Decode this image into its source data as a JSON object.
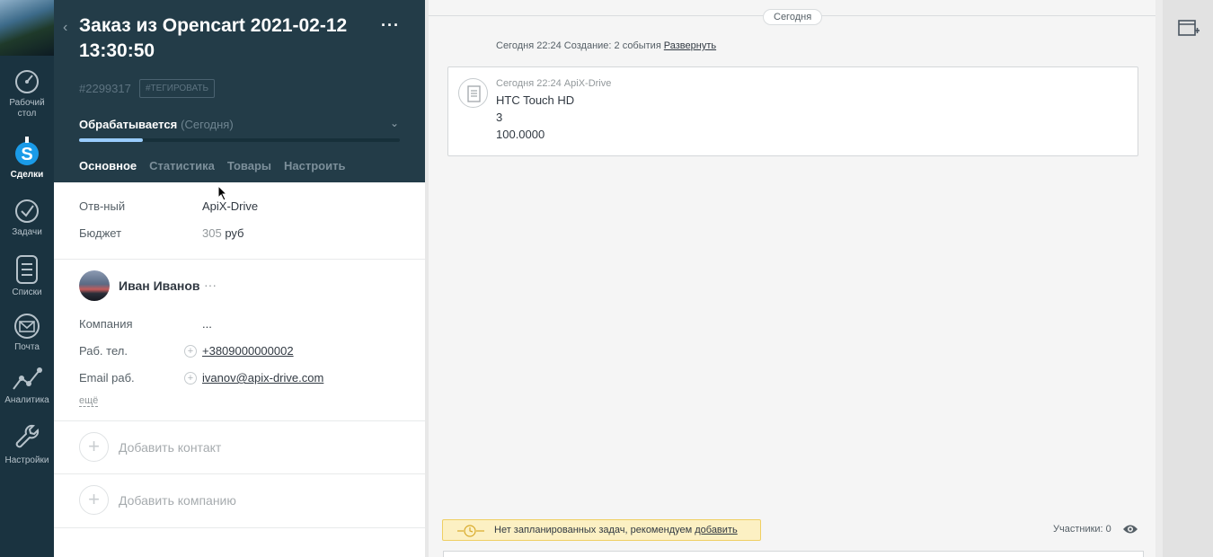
{
  "nav": {
    "items": [
      {
        "label": "Рабочий стол",
        "icon": "dashboard-icon"
      },
      {
        "label": "Сделки",
        "icon": "deals-icon"
      },
      {
        "label": "Задачи",
        "icon": "tasks-icon"
      },
      {
        "label": "Списки",
        "icon": "lists-icon"
      },
      {
        "label": "Почта",
        "icon": "mail-icon"
      },
      {
        "label": "Аналитика",
        "icon": "analytics-icon"
      },
      {
        "label": "Настройки",
        "icon": "settings-icon"
      }
    ]
  },
  "card": {
    "title": "Заказ из Opencart 2021-02-12 13:30:50",
    "id": "#2299317",
    "tag_button": "#ТЕГИРОВАТЬ",
    "status": "Обрабатывается",
    "status_date": "(Сегодня)",
    "progress_fraction": 0.2,
    "tabs": [
      "Основное",
      "Статистика",
      "Товары",
      "Настроить"
    ],
    "fields": {
      "responsible_label": "Отв-ный",
      "responsible_value": "ApiX-Drive",
      "budget_label": "Бюджет",
      "budget_amount": "305",
      "budget_currency": "руб"
    },
    "contact": {
      "name": "Иван Иванов",
      "dots": "···",
      "company_label": "Компания",
      "company_value": "...",
      "phone_label": "Раб. тел.",
      "phone_value": "+3809000000002",
      "email_label": "Email раб.",
      "email_value": "ivanov@apix-drive.com",
      "more": "ещё"
    },
    "add_contact": "Добавить контакт",
    "add_company": "Добавить компанию"
  },
  "feed": {
    "date_pill": "Сегодня",
    "summary": "Сегодня 22:24 Создание: 2 события",
    "expand": "Развернуть",
    "note": {
      "meta": "Сегодня 22:24 ApiX-Drive",
      "lines": [
        "HTC Touch HD",
        "3",
        "100.0000"
      ]
    },
    "task_bar": {
      "text": "Нет запланированных задач, рекомендуем",
      "add": "добавить"
    },
    "participants": "Участники: 0"
  },
  "colors": {
    "nav_bg": "#1a3340",
    "card_header_bg": "#233c48",
    "progress_fill": "#99ccfd",
    "task_bar_bg": "#fcf0c3",
    "task_bar_border": "#efcf63",
    "deals_icon_accent": "#1a9be8"
  }
}
